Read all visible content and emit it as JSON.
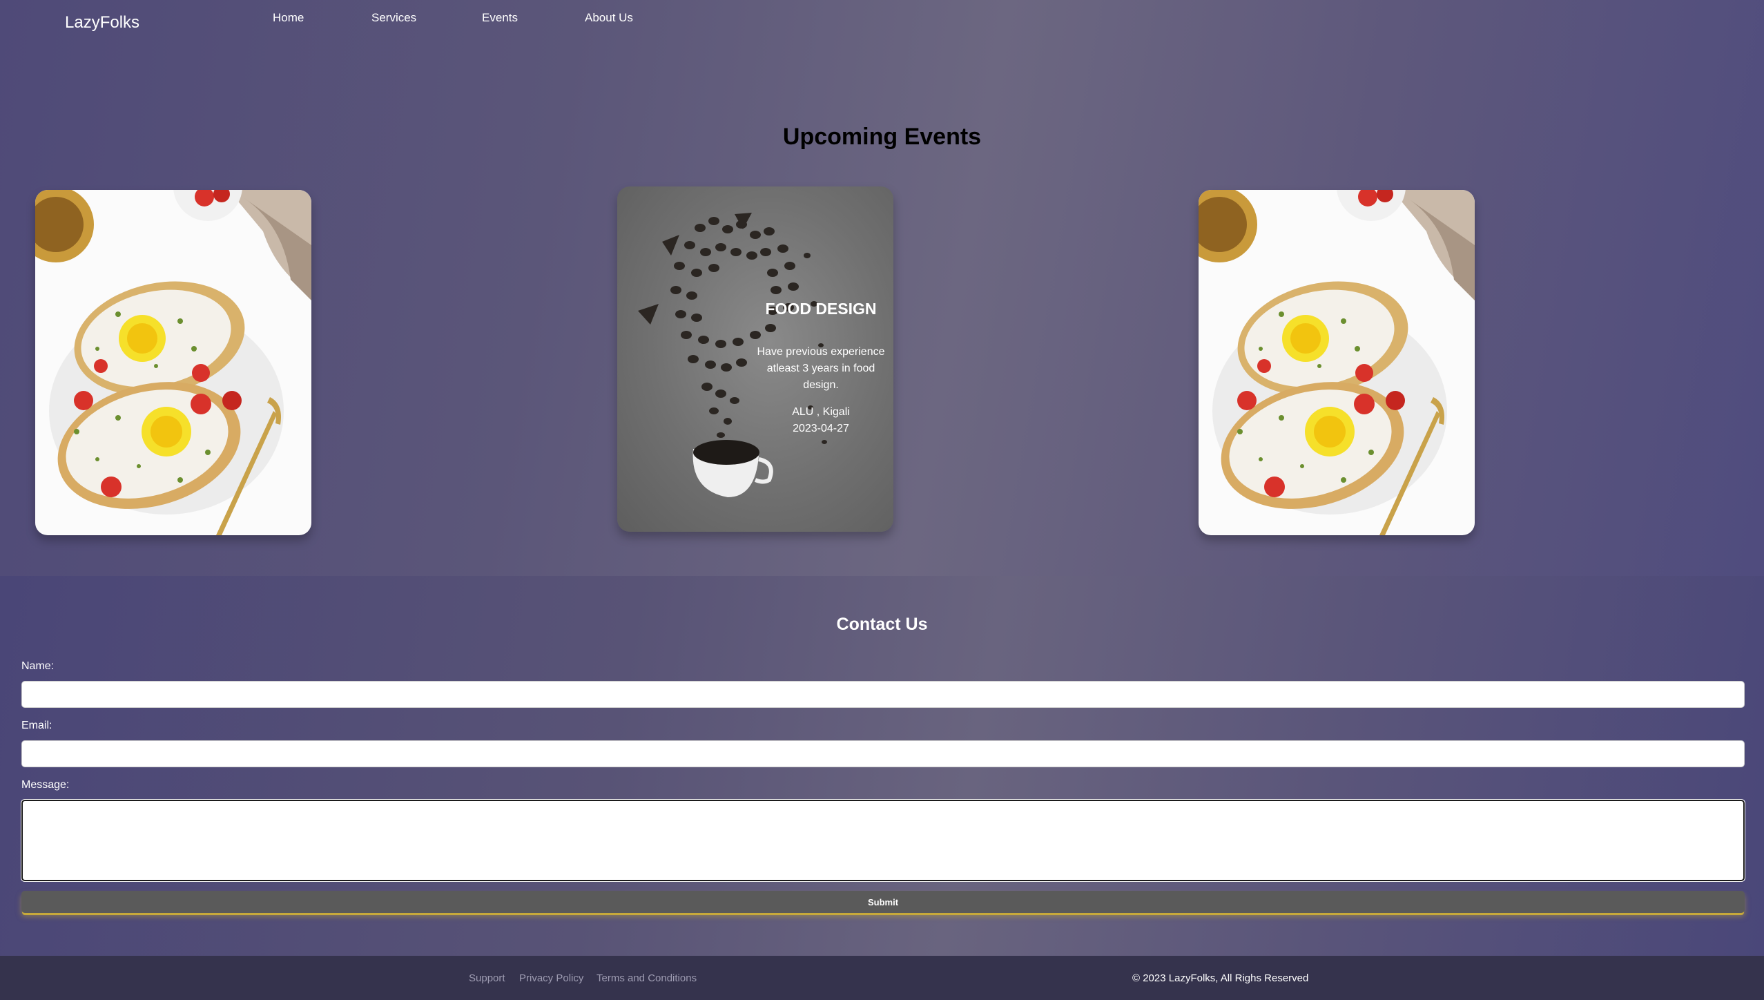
{
  "navbar": {
    "brand": "LazyFolks",
    "links": [
      "Home",
      "Services",
      "Events",
      "About Us"
    ]
  },
  "events": {
    "title": "Upcoming Events",
    "featured": {
      "title": "FOOD DESIGN",
      "description": "Have previous experience atleast 3 years in food design.",
      "location": "ALU , Kigali",
      "date": "2023-04-27"
    }
  },
  "contact": {
    "title": "Contact Us",
    "name_label": "Name:",
    "email_label": "Email:",
    "message_label": "Message:",
    "name_value": "",
    "email_value": "",
    "message_value": "",
    "submit_label": "Submit"
  },
  "footer": {
    "links": [
      "Support",
      "Privacy Policy",
      "Terms and Conditions"
    ],
    "copyright": "© 2023 LazyFolks, All Righs Reserved"
  }
}
